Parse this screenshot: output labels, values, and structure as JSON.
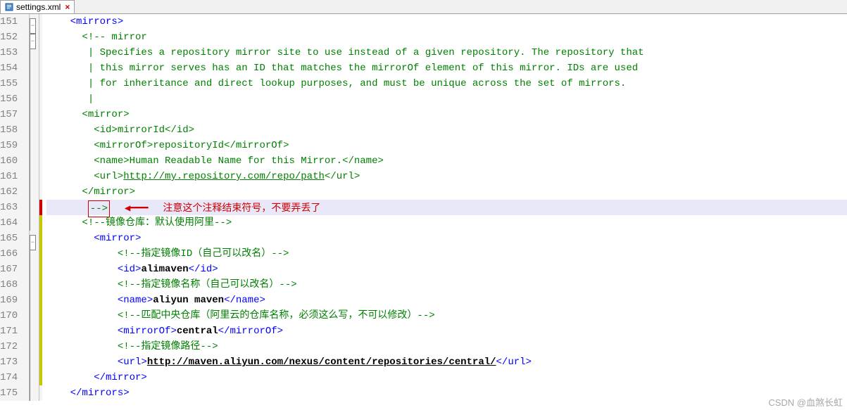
{
  "tab": {
    "filename": "settings.xml",
    "icon_name": "xml-file-icon"
  },
  "annotation": {
    "marker": "-->",
    "text": "注意这个注释结束符号，不要弄丢了"
  },
  "watermark": "CSDN @血煞长虹",
  "lines": [
    {
      "num": "151",
      "fold": "minus",
      "change": "",
      "indent": "    ",
      "segs": [
        {
          "c": "t-tag",
          "t": "<mirrors>"
        }
      ]
    },
    {
      "num": "152",
      "fold": "minus",
      "change": "",
      "indent": "      ",
      "segs": [
        {
          "c": "t-comment",
          "t": "<!-- mirror"
        }
      ]
    },
    {
      "num": "153",
      "fold": "line",
      "change": "",
      "indent": "       ",
      "segs": [
        {
          "c": "t-comment",
          "t": "| Specifies a repository mirror site to use instead of a given repository. The repository that"
        }
      ]
    },
    {
      "num": "154",
      "fold": "line",
      "change": "",
      "indent": "       ",
      "segs": [
        {
          "c": "t-comment",
          "t": "| this mirror serves has an ID that matches the mirrorOf element of this mirror. IDs are used"
        }
      ]
    },
    {
      "num": "155",
      "fold": "line",
      "change": "",
      "indent": "       ",
      "segs": [
        {
          "c": "t-comment",
          "t": "| for inheritance and direct lookup purposes, and must be unique across the set of mirrors."
        }
      ]
    },
    {
      "num": "156",
      "fold": "line",
      "change": "",
      "indent": "       ",
      "segs": [
        {
          "c": "t-comment",
          "t": "|"
        }
      ]
    },
    {
      "num": "157",
      "fold": "line",
      "change": "",
      "indent": "      ",
      "segs": [
        {
          "c": "t-comment",
          "t": "<mirror>"
        }
      ]
    },
    {
      "num": "158",
      "fold": "line",
      "change": "",
      "indent": "        ",
      "segs": [
        {
          "c": "t-comment",
          "t": "<id>mirrorId</id>"
        }
      ]
    },
    {
      "num": "159",
      "fold": "line",
      "change": "",
      "indent": "        ",
      "segs": [
        {
          "c": "t-comment",
          "t": "<mirrorOf>repositoryId</mirrorOf>"
        }
      ]
    },
    {
      "num": "160",
      "fold": "line",
      "change": "",
      "indent": "        ",
      "segs": [
        {
          "c": "t-comment",
          "t": "<name>Human Readable Name for this Mirror.</name>"
        }
      ]
    },
    {
      "num": "161",
      "fold": "line",
      "change": "",
      "indent": "        ",
      "segs": [
        {
          "c": "t-comment",
          "t": "<url>"
        },
        {
          "c": "t-url",
          "t": "http://my.repository.com/repo/path"
        },
        {
          "c": "t-comment",
          "t": "</url>"
        }
      ]
    },
    {
      "num": "162",
      "fold": "line",
      "change": "",
      "indent": "      ",
      "segs": [
        {
          "c": "t-comment",
          "t": "</mirror>"
        }
      ]
    },
    {
      "num": "163",
      "fold": "line",
      "change": "red",
      "indent": "       ",
      "hl": true,
      "annot": true,
      "segs": []
    },
    {
      "num": "164",
      "fold": "line",
      "change": "yellow",
      "indent": "      ",
      "segs": [
        {
          "c": "t-comment",
          "t": "<!--镜像仓库：默认使用阿里-->"
        }
      ]
    },
    {
      "num": "165",
      "fold": "minus",
      "change": "yellow",
      "indent": "        ",
      "segs": [
        {
          "c": "t-tag",
          "t": "<mirror>"
        }
      ]
    },
    {
      "num": "166",
      "fold": "line",
      "change": "yellow",
      "indent": "            ",
      "segs": [
        {
          "c": "t-comment",
          "t": "<!--指定镜像ID（自己可以改名）-->"
        }
      ]
    },
    {
      "num": "167",
      "fold": "line",
      "change": "yellow",
      "indent": "            ",
      "segs": [
        {
          "c": "t-tag",
          "t": "<id>"
        },
        {
          "c": "t-text",
          "t": "alimaven"
        },
        {
          "c": "t-tag",
          "t": "</id>"
        }
      ]
    },
    {
      "num": "168",
      "fold": "line",
      "change": "yellow",
      "indent": "            ",
      "segs": [
        {
          "c": "t-comment",
          "t": "<!--指定镜像名称（自己可以改名）-->"
        }
      ]
    },
    {
      "num": "169",
      "fold": "line",
      "change": "yellow",
      "indent": "            ",
      "segs": [
        {
          "c": "t-tag",
          "t": "<name>"
        },
        {
          "c": "t-text",
          "t": "aliyun maven"
        },
        {
          "c": "t-tag",
          "t": "</name>"
        }
      ]
    },
    {
      "num": "170",
      "fold": "line",
      "change": "yellow",
      "indent": "            ",
      "segs": [
        {
          "c": "t-comment",
          "t": "<!--匹配中央仓库（阿里云的仓库名称，必须这么写，不可以修改）-->"
        }
      ]
    },
    {
      "num": "171",
      "fold": "line",
      "change": "yellow",
      "indent": "            ",
      "segs": [
        {
          "c": "t-tag",
          "t": "<mirrorOf>"
        },
        {
          "c": "t-text",
          "t": "central"
        },
        {
          "c": "t-tag",
          "t": "</mirrorOf>"
        }
      ]
    },
    {
      "num": "172",
      "fold": "line",
      "change": "yellow",
      "indent": "            ",
      "segs": [
        {
          "c": "t-comment",
          "t": "<!--指定镜像路径-->"
        }
      ]
    },
    {
      "num": "173",
      "fold": "line",
      "change": "yellow",
      "indent": "            ",
      "segs": [
        {
          "c": "t-tag",
          "t": "<url>"
        },
        {
          "c": "t-url-bold",
          "t": "http://maven.aliyun.com/nexus/content/repositories/central/"
        },
        {
          "c": "t-tag",
          "t": "</url>"
        }
      ]
    },
    {
      "num": "174",
      "fold": "line",
      "change": "yellow",
      "indent": "        ",
      "segs": [
        {
          "c": "t-tag",
          "t": "</mirror>"
        }
      ]
    },
    {
      "num": "175",
      "fold": "line",
      "change": "",
      "indent": "    ",
      "segs": [
        {
          "c": "t-tag",
          "t": "</mirrors>"
        }
      ]
    }
  ]
}
